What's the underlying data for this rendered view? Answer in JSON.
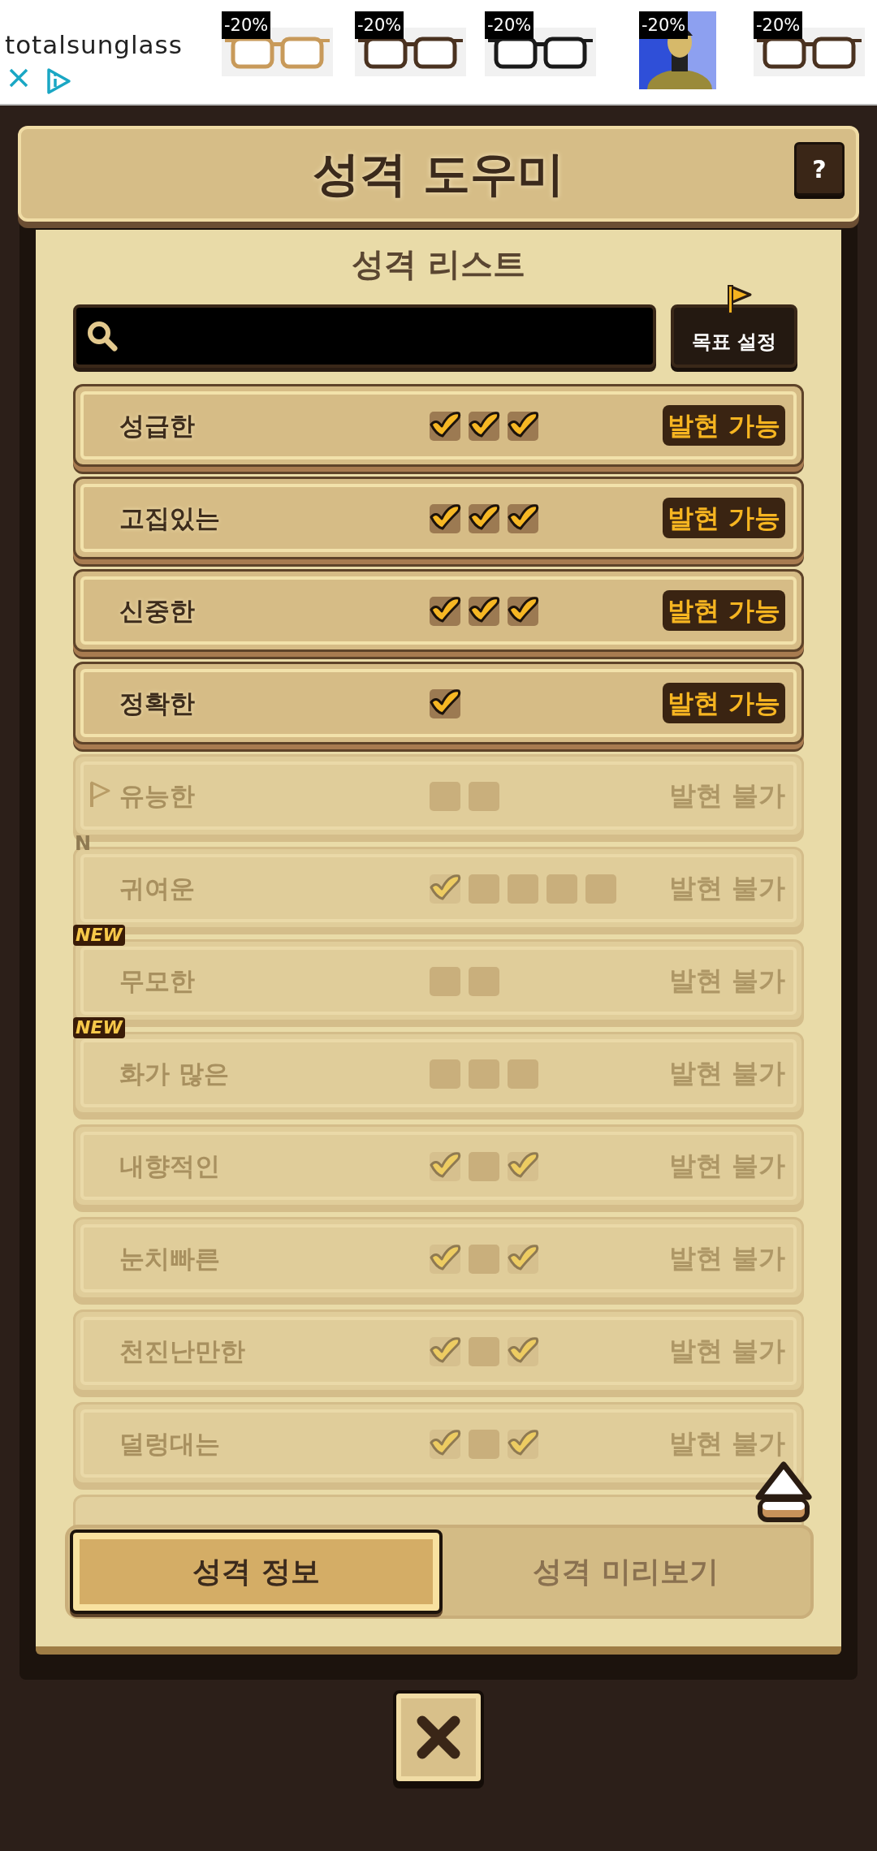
{
  "ad": {
    "brand": "totalsunglass",
    "products": [
      {
        "badge": "-20%",
        "kind": "glasses",
        "color": "#c89a5a"
      },
      {
        "badge": "-20%",
        "kind": "glasses",
        "color": "#4a3220"
      },
      {
        "badge": "-20%",
        "kind": "glasses",
        "color": "#1a1a1a"
      },
      {
        "badge": "-20%",
        "kind": "person",
        "color": "#2f4fd8"
      },
      {
        "badge": "-20%",
        "kind": "glasses",
        "color": "#4a3220"
      }
    ]
  },
  "header": {
    "title": "성격 도우미",
    "help_button": "?"
  },
  "list_title": "성격 리스트",
  "goal_button": "목표 설정",
  "rows": [
    {
      "name": "성급한",
      "available": true,
      "checks": [
        true,
        true,
        true
      ],
      "status": "발현 가능"
    },
    {
      "name": "고집있는",
      "available": true,
      "checks": [
        true,
        true,
        true
      ],
      "status": "발현 가능"
    },
    {
      "name": "신중한",
      "available": true,
      "checks": [
        true,
        true,
        true
      ],
      "status": "발현 가능"
    },
    {
      "name": "정확한",
      "available": true,
      "checks": [
        true
      ],
      "status": "발현 가능"
    },
    {
      "name": "유능한",
      "available": false,
      "goal": true,
      "checks": [
        false,
        false
      ],
      "status": "발현 불가"
    },
    {
      "name": "귀여운",
      "available": false,
      "badge": "N",
      "checks": [
        true,
        false,
        false,
        false,
        false
      ],
      "status": "발현 불가"
    },
    {
      "name": "무모한",
      "available": false,
      "badge": "NEW",
      "checks": [
        false,
        false
      ],
      "status": "발현 불가"
    },
    {
      "name": "화가 많은",
      "available": false,
      "badge": "NEW",
      "checks": [
        false,
        false,
        false
      ],
      "status": "발현 불가"
    },
    {
      "name": "내향적인",
      "available": false,
      "checks": [
        true,
        false,
        true
      ],
      "status": "발현 불가"
    },
    {
      "name": "눈치빠른",
      "available": false,
      "checks": [
        true,
        false,
        true
      ],
      "status": "발현 불가"
    },
    {
      "name": "천진난만한",
      "available": false,
      "checks": [
        true,
        false,
        true
      ],
      "status": "발현 불가"
    },
    {
      "name": "덜렁대는",
      "available": false,
      "checks": [
        true,
        false,
        true
      ],
      "status": "발현 불가"
    }
  ],
  "tabs": [
    {
      "label": "성격 정보",
      "selected": true
    },
    {
      "label": "성격 미리보기",
      "selected": false
    }
  ]
}
